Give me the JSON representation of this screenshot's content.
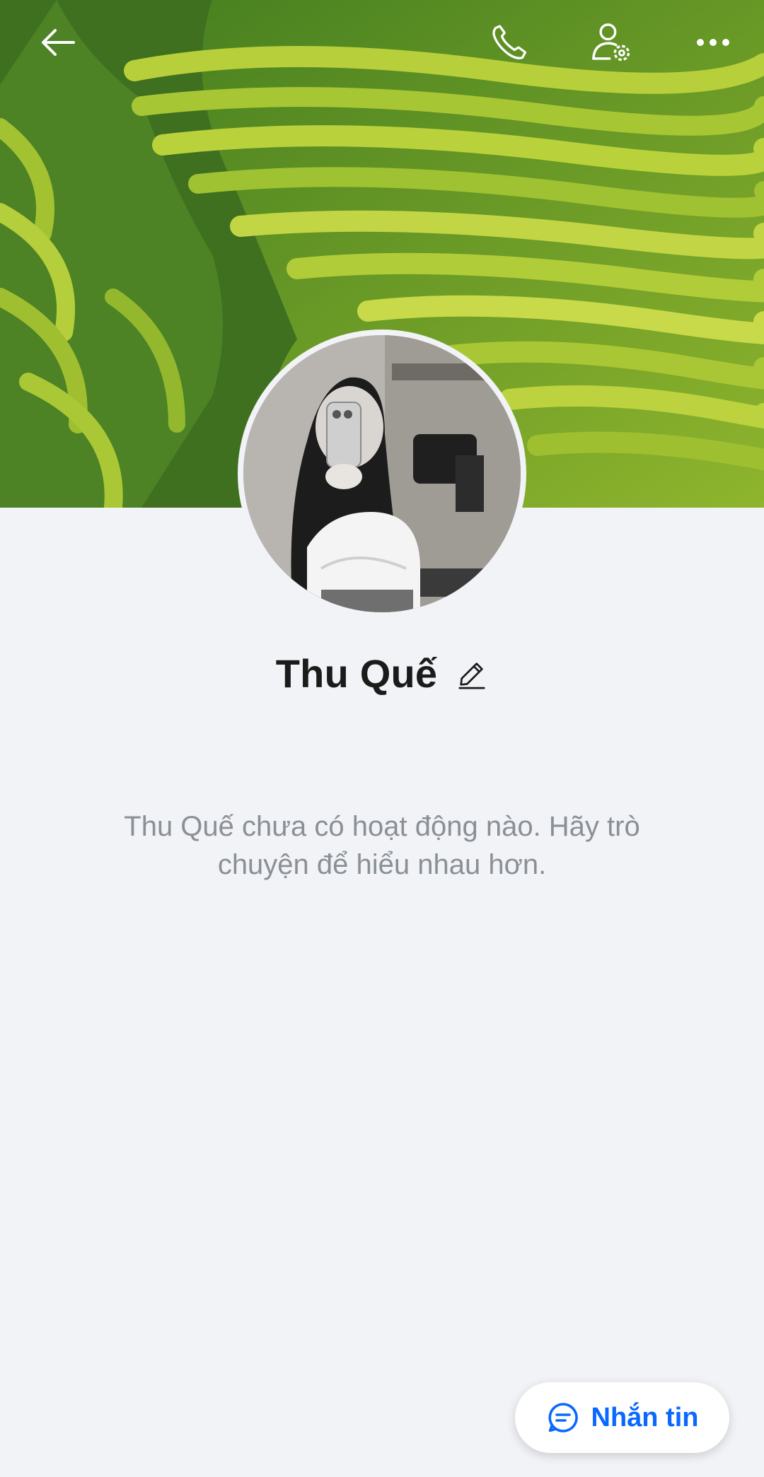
{
  "profile": {
    "name": "Thu Quế",
    "empty_message": "Thu Quế chưa có hoạt động nào. Hãy trò chuyện để hiểu nhau hơn."
  },
  "toolbar": {
    "icons": [
      "back-arrow-icon",
      "phone-icon",
      "user-settings-icon",
      "more-icon"
    ]
  },
  "actions": {
    "message_label": "Nhắn tin",
    "message_icon": "chat-bubble-icon"
  },
  "colors": {
    "accent": "#0a68ff",
    "background": "#f1f3f6",
    "name_text": "#1b1b1b",
    "muted_text": "#8a9097"
  }
}
